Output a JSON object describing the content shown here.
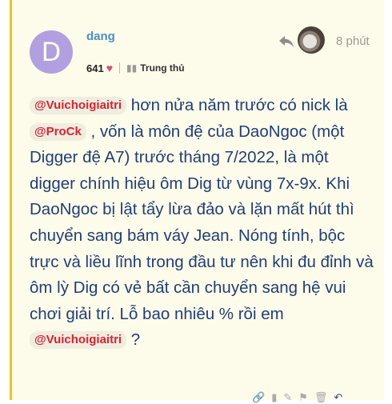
{
  "post": {
    "avatar_letter": "D",
    "username": "dang",
    "likes": "641",
    "badge": "Trung thủ",
    "time": "8 phút"
  },
  "content": {
    "mention1": "@Vuichoigiaitri",
    "seg1": " hơn nửa năm trước có nick là ",
    "mention2": "@ProCk",
    "seg2": " , vốn là môn đệ của DaoNgoc (một Digger đệ A7) trước tháng 7/2022, là một digger chính hiệu ôm Dig từ vùng 7x-9x. Khi DaoNgoc bị lật tẩy lừa đảo và lặn mất hút thì chuyển sang bám váy Jean. Nóng tính, bộc trực và liều lĩnh trong đầu tư nên khi đu đỉnh và ôm lỳ Dig có vẻ bất cần chuyển sang hệ vui chơi giải trí. Lỗ bao nhiêu % rồi em ",
    "mention3": "@Vuichoigiaitri",
    "seg3": " ?"
  },
  "icons": {
    "heart": "heart-icon",
    "badge": "trophy-icon",
    "reply": "reply-arrow-icon",
    "actions": [
      "link-icon",
      "bookmark-icon",
      "edit-icon",
      "flag-icon",
      "trash-icon",
      "reply-icon"
    ]
  },
  "colors": {
    "post_background": "#fdfbe9",
    "accent_border": "#f0c419",
    "avatar": "#b29fe0",
    "username": "#4a90c8",
    "body_text": "#1f3f7a",
    "mention_text": "#d8242f"
  }
}
